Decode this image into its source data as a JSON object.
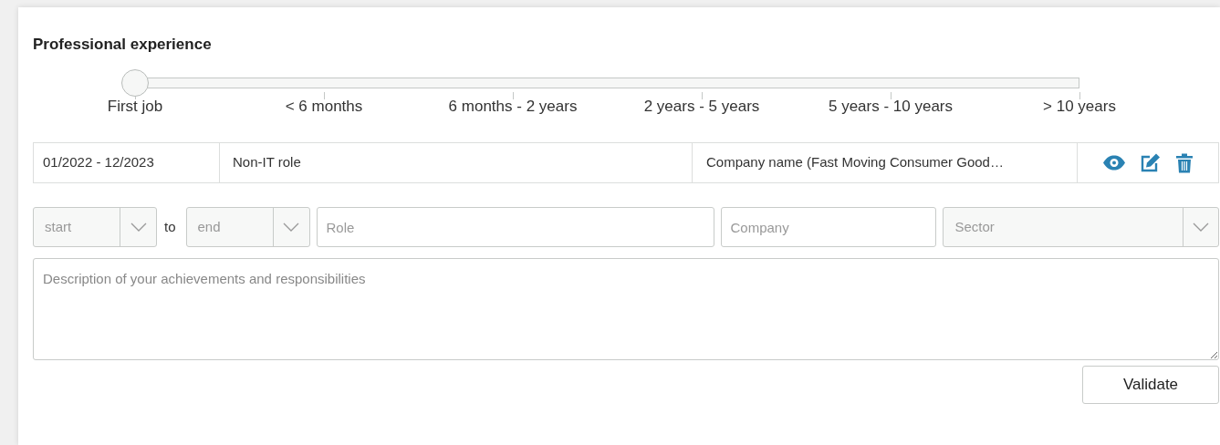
{
  "section": {
    "title": "Professional experience"
  },
  "experience_slider": {
    "level": 0,
    "labels": [
      "First job",
      "< 6 months",
      "6 months - 2 years",
      "2 years - 5 years",
      "5 years - 10 years",
      "> 10 years"
    ]
  },
  "entries": [
    {
      "dates": "01/2022 - 12/2023",
      "role": "Non-IT role",
      "company": "Company name (Fast Moving Consumer Good…"
    }
  ],
  "form": {
    "start": {
      "placeholder": "start"
    },
    "separator": "to",
    "end": {
      "placeholder": "end"
    },
    "role": {
      "placeholder": "Role"
    },
    "company": {
      "placeholder": "Company"
    },
    "sector": {
      "placeholder": "Sector"
    },
    "description": {
      "placeholder": "Description of your achievements and responsibilities"
    },
    "submit": "Validate"
  }
}
